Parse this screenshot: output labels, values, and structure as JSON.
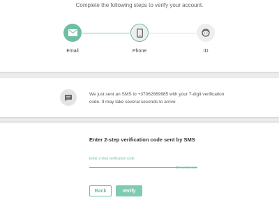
{
  "header": {
    "intro_text": "Complete the following steps to verify your account."
  },
  "steps": [
    {
      "label": "Email",
      "icon": "envelope-icon",
      "state": "done"
    },
    {
      "label": "Phone",
      "icon": "phone-icon",
      "state": "active"
    },
    {
      "label": "ID",
      "icon": "face-icon",
      "state": "pending"
    }
  ],
  "info": {
    "icon": "chat-icon",
    "message": "We just sent an SMS to +37062869985 with your 7-digit verification code. It may take several seconds to arrive"
  },
  "form": {
    "title": "Enter 2-step verification code sent by SMS",
    "code_input": {
      "placeholder": "Enter 2-step verification code",
      "value": ""
    },
    "resend_label": "Re-send code",
    "back_label": "Back",
    "verify_label": "Verify"
  },
  "colors": {
    "accent": "#6fbea3",
    "background": "#ececec",
    "panel": "#ffffff"
  }
}
